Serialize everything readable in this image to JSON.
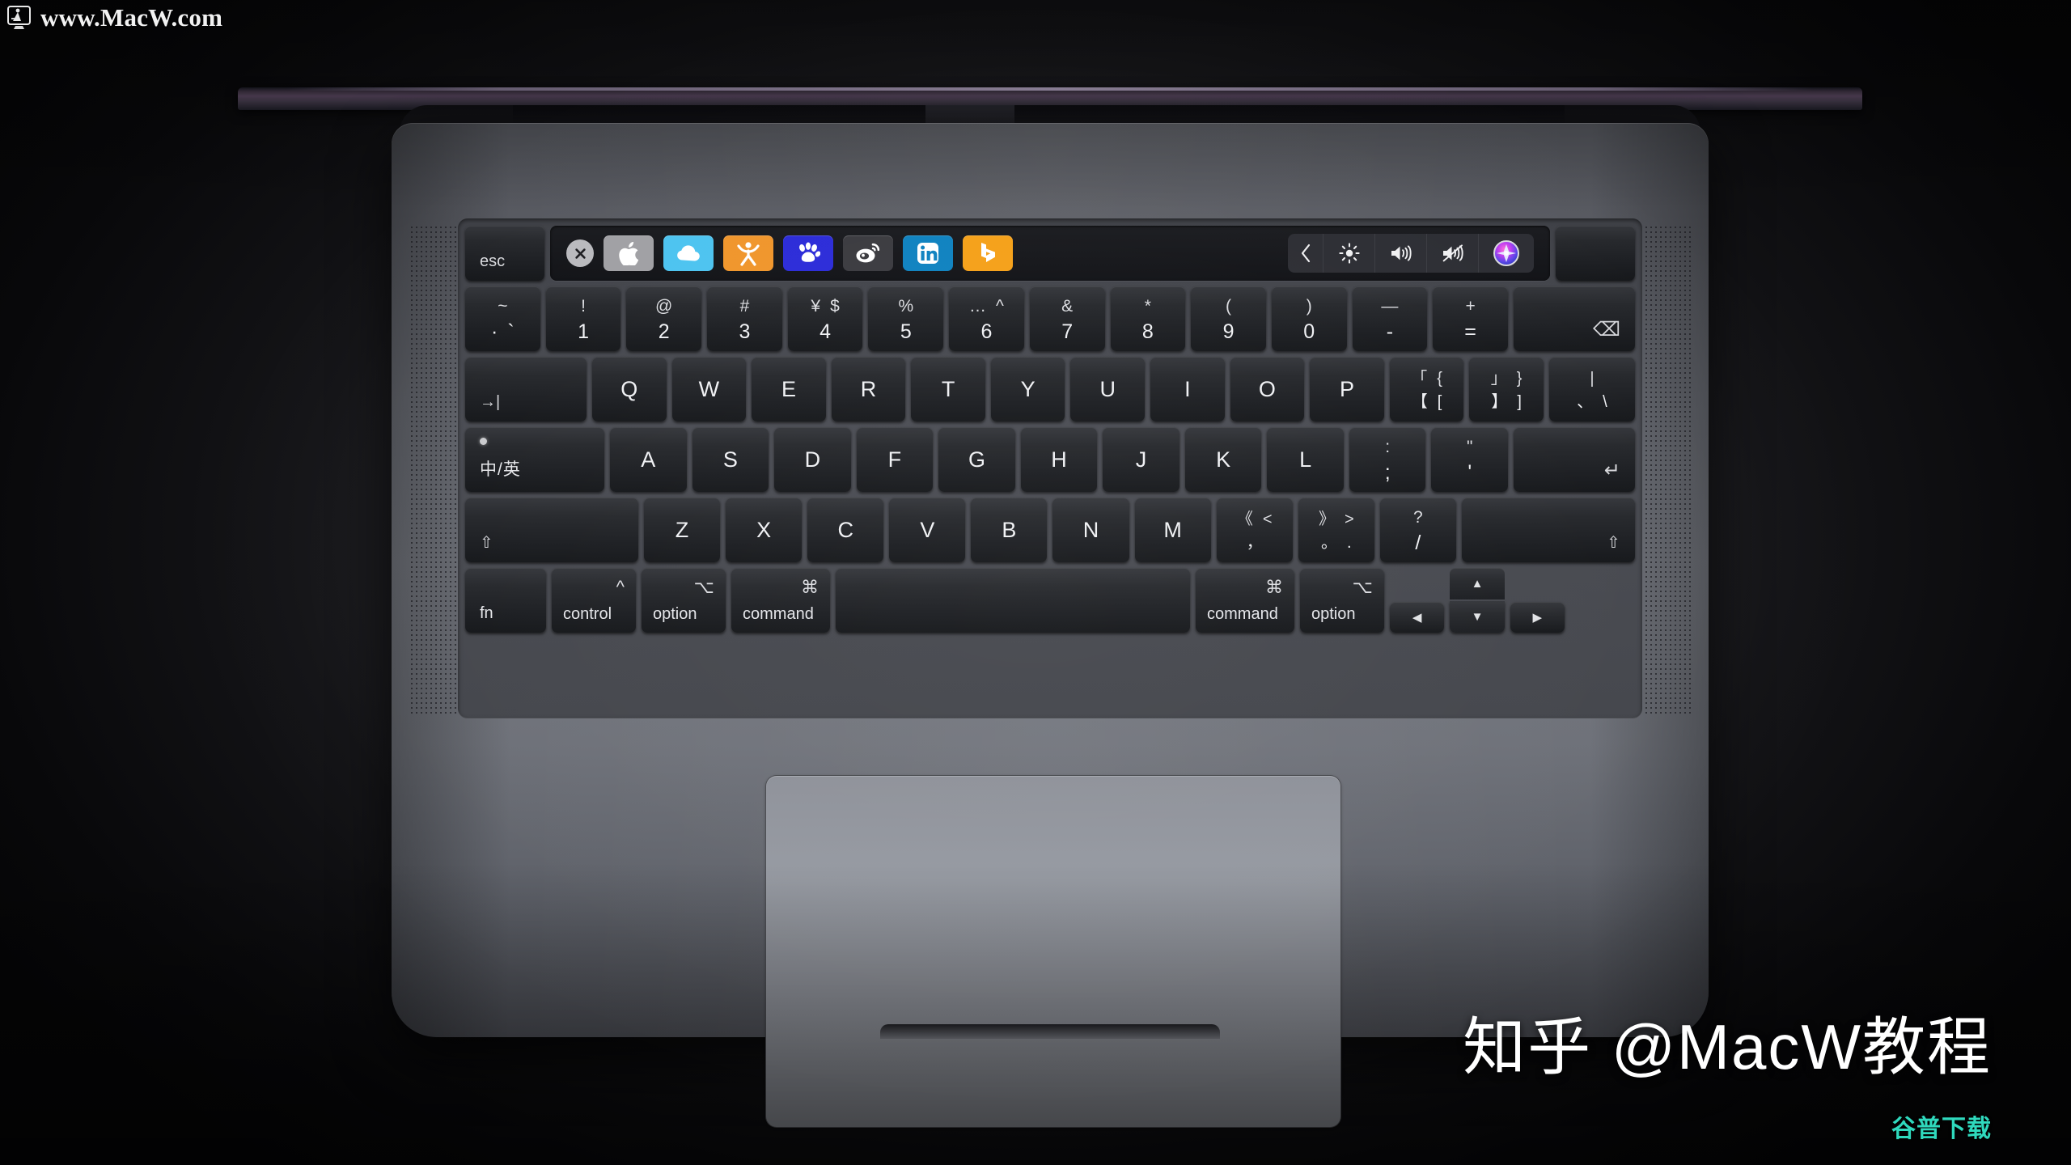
{
  "watermarks": {
    "top_left": "www.MacW.com",
    "bottom_right_main": "知乎 @MacW教程",
    "bottom_right_sub": "谷普下载",
    "sub_color": "#2fd9bd"
  },
  "device": {
    "name": "MacBook Pro",
    "finish": "Space Gray",
    "body_color": "#74777f",
    "key_color": "#26282c"
  },
  "touchbar": {
    "esc_label": "esc",
    "close_label": "✕",
    "apps": [
      {
        "name": "apple-app",
        "icon": "apple-icon",
        "bg": "#a0a0a4"
      },
      {
        "name": "cloud-app",
        "icon": "cloud-icon",
        "bg": "#4cc3f0"
      },
      {
        "name": "person-app",
        "icon": "person-icon",
        "bg": "#f0952b"
      },
      {
        "name": "baidu-app",
        "icon": "paw-icon",
        "bg": "#2b2bd8"
      },
      {
        "name": "weibo-app",
        "icon": "weibo-icon",
        "bg": "#3a3a3f"
      },
      {
        "name": "linkedin-app",
        "icon": "linkedin-icon",
        "bg": "#0e82c0"
      },
      {
        "name": "bing-app",
        "icon": "bing-icon",
        "bg": "#f5a018"
      }
    ],
    "controls": [
      {
        "name": "expand-control-strip",
        "icon": "chevron-left-icon"
      },
      {
        "name": "brightness",
        "icon": "brightness-icon"
      },
      {
        "name": "volume-up",
        "icon": "volume-up-icon"
      },
      {
        "name": "mute",
        "icon": "volume-mute-icon"
      },
      {
        "name": "siri",
        "icon": "siri-icon"
      }
    ]
  },
  "keyboard": {
    "number_row": [
      {
        "name": "key-backtick",
        "top": "~",
        "top2": "",
        "bot": "·",
        "bot2": "`"
      },
      {
        "name": "key-1",
        "top": "!",
        "top2": "",
        "bot": "1",
        "bot2": ""
      },
      {
        "name": "key-2",
        "top": "@",
        "top2": "",
        "bot": "2",
        "bot2": ""
      },
      {
        "name": "key-3",
        "top": "#",
        "top2": "",
        "bot": "3",
        "bot2": ""
      },
      {
        "name": "key-4",
        "top": "¥",
        "top2": "$",
        "bot": "4",
        "bot2": ""
      },
      {
        "name": "key-5",
        "top": "%",
        "top2": "",
        "bot": "5",
        "bot2": ""
      },
      {
        "name": "key-6",
        "top": "…",
        "top2": "^",
        "bot": "6",
        "bot2": ""
      },
      {
        "name": "key-7",
        "top": "&",
        "top2": "",
        "bot": "7",
        "bot2": ""
      },
      {
        "name": "key-8",
        "top": "*",
        "top2": "",
        "bot": "8",
        "bot2": ""
      },
      {
        "name": "key-9",
        "top": "(",
        "top2": "",
        "bot": "9",
        "bot2": ""
      },
      {
        "name": "key-0",
        "top": ")",
        "top2": "",
        "bot": "0",
        "bot2": ""
      },
      {
        "name": "key-minus",
        "top": "—",
        "top2": "",
        "bot": "-",
        "bot2": ""
      },
      {
        "name": "key-equal",
        "top": "+",
        "top2": "",
        "bot": "=",
        "bot2": ""
      }
    ],
    "delete_label": "⌫",
    "tab_label": "→|",
    "qwerty_row": [
      "Q",
      "W",
      "E",
      "R",
      "T",
      "Y",
      "U",
      "I",
      "O",
      "P"
    ],
    "qwerty_extra": [
      {
        "name": "key-bracket-left",
        "top": "「",
        "top2": "{",
        "bot": "【",
        "bot2": "["
      },
      {
        "name": "key-bracket-right",
        "top": "」",
        "top2": "}",
        "bot": "】",
        "bot2": "]"
      },
      {
        "name": "key-backslash",
        "top": "|",
        "top2": "",
        "bot": "、",
        "bot2": "\\"
      }
    ],
    "caps_label": "中/英",
    "home_row": [
      "A",
      "S",
      "D",
      "F",
      "G",
      "H",
      "J",
      "K",
      "L"
    ],
    "home_extra": [
      {
        "name": "key-semicolon",
        "top": ":",
        "top2": "",
        "bot": ";",
        "bot2": ""
      },
      {
        "name": "key-quote",
        "top": "\"",
        "top2": "",
        "bot": "'",
        "bot2": ""
      }
    ],
    "return_label": "↵",
    "shift_label": "⇧",
    "shift_row": [
      "Z",
      "X",
      "C",
      "V",
      "B",
      "N",
      "M"
    ],
    "shift_extra": [
      {
        "name": "key-comma",
        "top": "《",
        "top2": "<",
        "bot": "，",
        "bot2": ""
      },
      {
        "name": "key-period",
        "top": "》",
        "top2": ">",
        "bot": "。",
        "bot2": "."
      },
      {
        "name": "key-slash",
        "top": "?",
        "top2": "",
        "bot": "/",
        "bot2": ""
      }
    ],
    "bottom_row": [
      {
        "name": "key-fn",
        "sym": "",
        "label": "fn"
      },
      {
        "name": "key-control",
        "sym": "^",
        "label": "control"
      },
      {
        "name": "key-option-left",
        "sym": "⌥",
        "label": "option"
      },
      {
        "name": "key-command-left",
        "sym": "⌘",
        "label": "command"
      },
      {
        "name": "key-space",
        "sym": "",
        "label": ""
      },
      {
        "name": "key-command-right",
        "sym": "⌘",
        "label": "command"
      },
      {
        "name": "key-option-right",
        "sym": "⌥",
        "label": "option"
      }
    ],
    "arrows": {
      "left": "◀",
      "up": "▲",
      "down": "▼",
      "right": "▶"
    }
  }
}
